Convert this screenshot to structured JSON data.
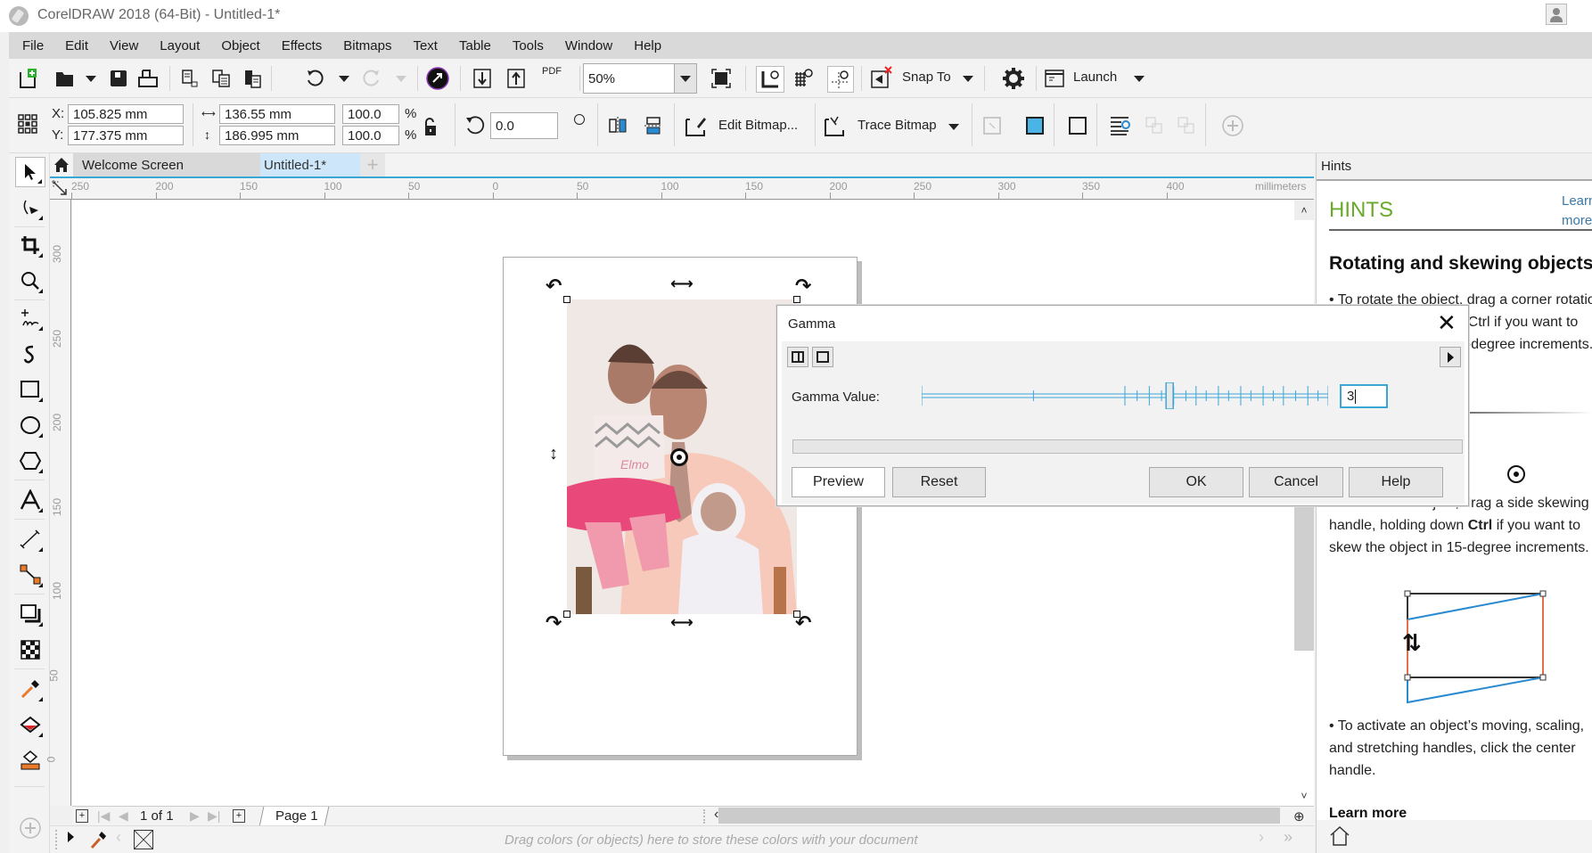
{
  "window": {
    "title": "CorelDRAW 2018 (64-Bit) - Untitled-1*"
  },
  "menu": [
    "File",
    "Edit",
    "View",
    "Layout",
    "Object",
    "Effects",
    "Bitmaps",
    "Text",
    "Table",
    "Tools",
    "Window",
    "Help"
  ],
  "toolbar": {
    "zoom_level": "50%",
    "snap_to_label": "Snap To",
    "launch_label": "Launch",
    "pdf_label": "PDF"
  },
  "property_bar": {
    "x_label": "X:",
    "y_label": "Y:",
    "x_value": "105.825 mm",
    "y_value": "177.375 mm",
    "width_value": "136.55 mm",
    "height_value": "186.995 mm",
    "scale_x": "100.0",
    "scale_y": "100.0",
    "percent": "%",
    "rotation": "0.0",
    "degree_symbol": "°",
    "edit_bitmap_label": "Edit Bitmap...",
    "trace_bitmap_label": "Trace Bitmap"
  },
  "doc_tabs": {
    "welcome": "Welcome Screen",
    "active": "Untitled-1*"
  },
  "ruler": {
    "unit": "millimeters",
    "h_ticks": [
      "250",
      "200",
      "150",
      "100",
      "50",
      "0",
      "50",
      "100",
      "150",
      "200",
      "250",
      "300",
      "350",
      "400"
    ],
    "v_ticks": [
      "300",
      "250",
      "200",
      "150",
      "100",
      "50",
      "0"
    ]
  },
  "page_nav": {
    "current": "1",
    "of_label": "of",
    "total": "1",
    "page_tab": "Page 1"
  },
  "color_bar": {
    "hint": "Drag colors (or objects) here to store these colors with your document"
  },
  "hints": {
    "header": "Hints",
    "title": "HINTS",
    "learn_more_top_1": "Learn",
    "learn_more_top_2": "more",
    "heading": "Rotating and skewing objects",
    "p1_lines": [
      "• To rotate the object, drag a corner rotation",
      "handle, holding down Ctrl if you want to",
      "rotate the object in 15-degree increments."
    ],
    "p2_lines": [
      "• To skew the object, drag a side skewing",
      "handle, holding down",
      "skew the object in 15-degree increments."
    ],
    "ctrl": "Ctrl",
    "p2_line2_tail": "if you want to",
    "p3_lines": [
      "• To activate an object’s moving, scaling,",
      "and stretching handles, click the center",
      "handle."
    ],
    "learn_more": "Learn more"
  },
  "gamma_dialog": {
    "title": "Gamma",
    "gamma_label": "Gamma Value:",
    "gamma_value": "3",
    "slider_position": 0.61,
    "preview_label": "Preview",
    "reset_label": "Reset",
    "ok_label": "OK",
    "cancel_label": "Cancel",
    "help_label": "Help"
  },
  "colors": {
    "accent": "#3aa6d6",
    "hints_green": "#6aaa2a",
    "menubar": "#d9d9d9",
    "active_tab": "#cde6fa"
  }
}
